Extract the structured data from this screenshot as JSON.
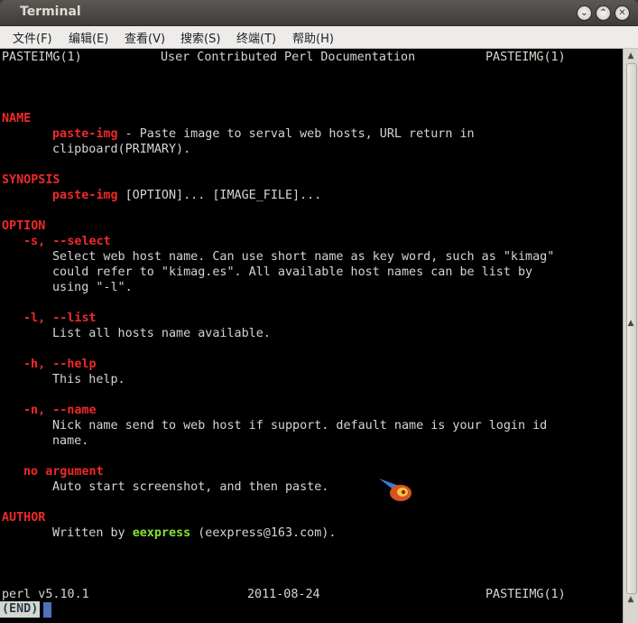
{
  "window": {
    "title": "Terminal"
  },
  "menu": [
    "文件(F)",
    "编辑(E)",
    "查看(V)",
    "搜索(S)",
    "终端(T)",
    "帮助(H)"
  ],
  "man": {
    "header_left": "PASTEIMG(1)",
    "header_center": "User Contributed Perl Documentation",
    "header_right": "PASTEIMG(1)",
    "name_heading": "NAME",
    "name_cmd": "paste-img",
    "name_desc1": " - Paste image to serval web hosts, URL return in",
    "name_desc2": "clipboard(PRIMARY).",
    "synopsis_heading": "SYNOPSIS",
    "synopsis_cmd": "paste-img",
    "synopsis_args": " [OPTION]... [IMAGE_FILE]...",
    "option_heading": "OPTION",
    "opt_s": "-s, --select",
    "opt_s_desc1": "Select web host name. Can use short name as key word, such as \"kimag\"",
    "opt_s_desc2": "could refer to \"kimag.es\". All available host names can be list by",
    "opt_s_desc3": "using \"-l\".",
    "opt_l": "-l, --list",
    "opt_l_desc": "List all hosts name available.",
    "opt_h": "-h, --help",
    "opt_h_desc": "This help.",
    "opt_n": "-n, --name",
    "opt_n_desc1": "Nick name send to web host if support. default name is your login id",
    "opt_n_desc2": "name.",
    "opt_none": "no argument",
    "opt_none_desc": "Auto start screenshot, and then paste.",
    "author_heading": "AUTHOR",
    "author_prefix": "Written by ",
    "author_name": "eexpress",
    "author_suffix": " (eexpress@163.com).",
    "footer_left": "perl v5.10.1",
    "footer_center": "2011-08-24",
    "footer_right": "PASTEIMG(1)",
    "end_badge": "(END)"
  },
  "colors": {
    "heading": "#ef2929",
    "author_name": "#8ae234",
    "text": "#d3d7cf",
    "background": "#000000"
  }
}
